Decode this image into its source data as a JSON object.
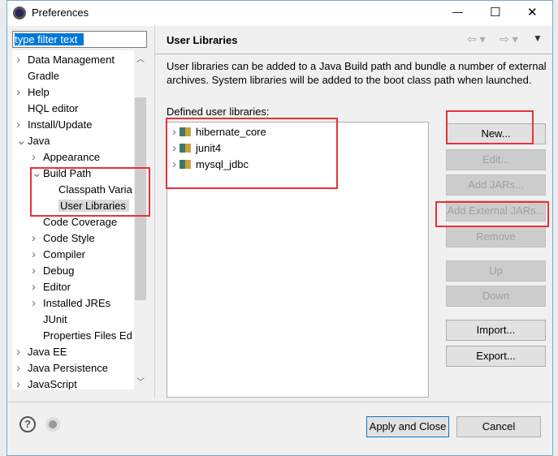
{
  "window": {
    "title": "Preferences",
    "minimize": "—",
    "maximize": "☐",
    "close": "✕"
  },
  "filter": {
    "value": "type filter text"
  },
  "tree": [
    {
      "label": "Data Management",
      "indent": 0,
      "chevron": ">"
    },
    {
      "label": "Gradle",
      "indent": 0,
      "chevron": ""
    },
    {
      "label": "Help",
      "indent": 0,
      "chevron": ">"
    },
    {
      "label": "HQL editor",
      "indent": 0,
      "chevron": ""
    },
    {
      "label": "Install/Update",
      "indent": 0,
      "chevron": ">"
    },
    {
      "label": "Java",
      "indent": 0,
      "chevron": "v"
    },
    {
      "label": "Appearance",
      "indent": 1,
      "chevron": ">"
    },
    {
      "label": "Build Path",
      "indent": 1,
      "chevron": "v"
    },
    {
      "label": "Classpath Varia",
      "indent": 2,
      "chevron": ""
    },
    {
      "label": "User Libraries",
      "indent": 2,
      "chevron": "",
      "selected": true
    },
    {
      "label": "Code Coverage",
      "indent": 1,
      "chevron": ""
    },
    {
      "label": "Code Style",
      "indent": 1,
      "chevron": ">"
    },
    {
      "label": "Compiler",
      "indent": 1,
      "chevron": ">"
    },
    {
      "label": "Debug",
      "indent": 1,
      "chevron": ">"
    },
    {
      "label": "Editor",
      "indent": 1,
      "chevron": ">"
    },
    {
      "label": "Installed JREs",
      "indent": 1,
      "chevron": ">"
    },
    {
      "label": "JUnit",
      "indent": 1,
      "chevron": ""
    },
    {
      "label": "Properties Files Ed",
      "indent": 1,
      "chevron": ""
    },
    {
      "label": "Java EE",
      "indent": 0,
      "chevron": ">"
    },
    {
      "label": "Java Persistence",
      "indent": 0,
      "chevron": ">"
    },
    {
      "label": "JavaScript",
      "indent": 0,
      "chevron": ">"
    }
  ],
  "page": {
    "title": "User Libraries",
    "description": "User libraries can be added to a Java Build path and bundle a number of external archives. System libraries will be added to the boot class path when launched.",
    "list_label": "Defined user libraries:",
    "libraries": [
      "hibernate_core",
      "junit4",
      "mysql_jdbc"
    ],
    "buttons": [
      {
        "label": "New...",
        "enabled": true
      },
      {
        "label": "Edit...",
        "enabled": false
      },
      {
        "label": "Add JARs...",
        "enabled": false
      },
      {
        "label": "Add External JARs...",
        "enabled": false
      },
      {
        "label": "Remove",
        "enabled": false
      },
      {
        "label": "Up",
        "enabled": false
      },
      {
        "label": "Down",
        "enabled": false
      },
      {
        "label": "Import...",
        "enabled": true
      },
      {
        "label": "Export...",
        "enabled": true
      }
    ]
  },
  "footer": {
    "apply_close": "Apply and Close",
    "cancel": "Cancel",
    "help_icon": "?"
  },
  "colors": {
    "highlight": "#e8313a",
    "selection": "#0078d7"
  }
}
